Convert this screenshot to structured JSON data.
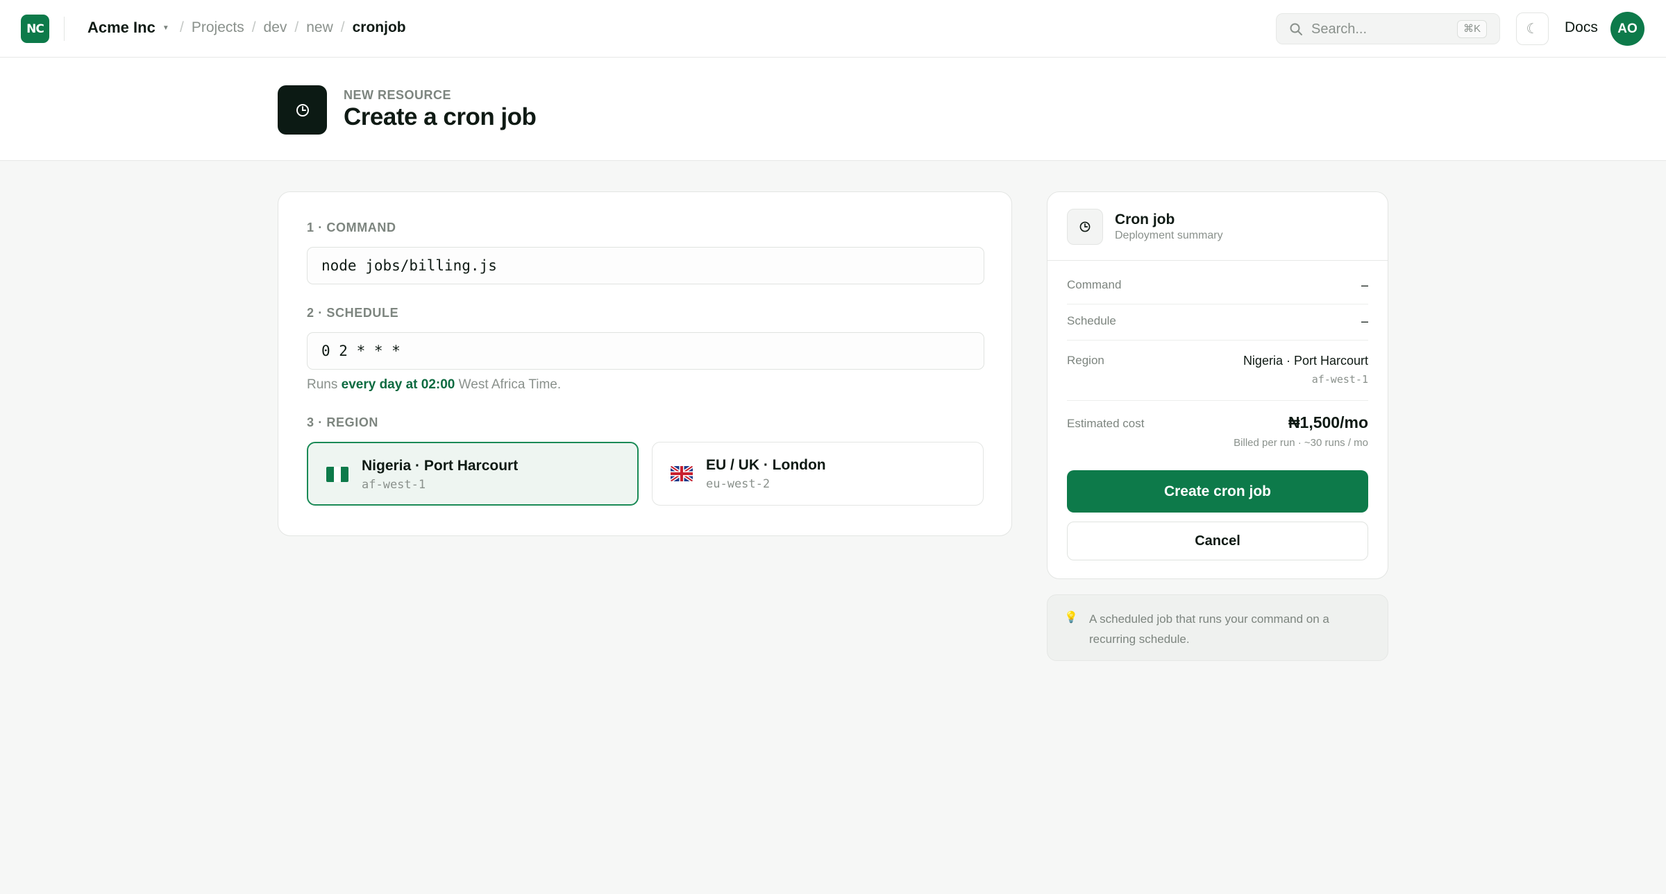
{
  "app": {
    "logo_text": "NC",
    "org_name": "Acme Inc",
    "breadcrumbs": [
      "Projects",
      "dev",
      "new",
      "cronjob"
    ]
  },
  "topbar": {
    "search_placeholder": "Search...",
    "search_shortcut": "⌘K",
    "theme_icon": "moon-icon",
    "docs_label": "Docs",
    "avatar_initials": "AO"
  },
  "page": {
    "eyebrow": "NEW RESOURCE",
    "title": "Create a cron job"
  },
  "form": {
    "command": {
      "label": "1 · COMMAND",
      "value": "node jobs/billing.js"
    },
    "schedule": {
      "label": "2 · SCHEDULE",
      "value": "0 2 * * *",
      "hint_prefix": "Runs",
      "hint_emphasis": "every day at 02:00",
      "hint_suffix": "West Africa Time."
    },
    "region": {
      "label": "3 · REGION",
      "options": [
        {
          "name": "Nigeria · Port Harcourt",
          "code": "af-west-1",
          "selected": true
        },
        {
          "name": "EU / UK · London",
          "code": "eu-west-2",
          "selected": false
        }
      ]
    }
  },
  "summary": {
    "title": "Cron job",
    "subtitle": "Deployment summary",
    "rows": {
      "command": {
        "label": "Command",
        "value": "–"
      },
      "schedule": {
        "label": "Schedule",
        "value": "–"
      },
      "region": {
        "label": "Region",
        "value": "Nigeria · Port Harcourt",
        "code": "af-west-1"
      },
      "cost": {
        "label": "Estimated cost",
        "value": "₦1,500/mo",
        "note": "Billed per run · ~30 runs / mo"
      }
    },
    "primary_action": "Create cron job",
    "secondary_action": "Cancel"
  },
  "tip": {
    "icon": "lightbulb-icon",
    "text": "A scheduled job that runs your command on a recurring schedule."
  },
  "colors": {
    "brand": "#0d7a4a",
    "selected_bg": "#eef5f1",
    "emphasis_text": "#0d6b41"
  }
}
